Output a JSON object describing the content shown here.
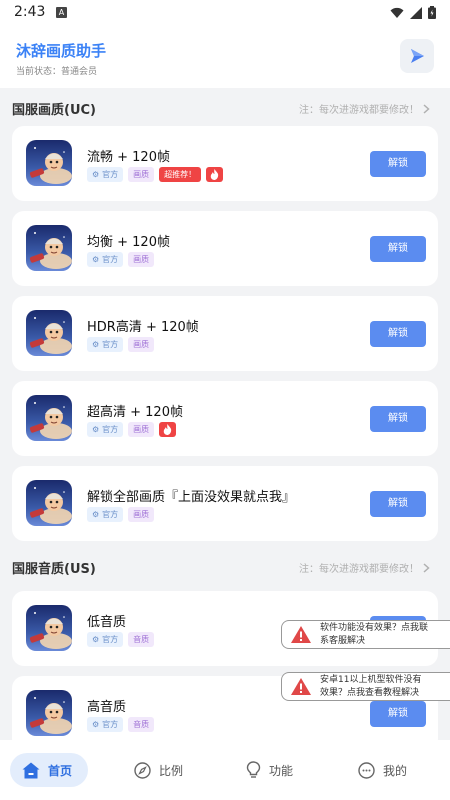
{
  "status_bar": {
    "time": "2:43"
  },
  "header": {
    "title": "沐辞画质助手",
    "member_status": "当前状态：普通会员"
  },
  "sections": [
    {
      "title": "国服画质(UC)",
      "note": "注：每次进游戏都要修改！"
    },
    {
      "title": "国服音质(US)",
      "note": "注：每次进游戏都要修改！"
    }
  ],
  "tag_labels": {
    "official": "官方",
    "quality": "画质",
    "audio": "音质",
    "recommend": "超推荐！"
  },
  "cards": [
    {
      "name": "流畅 + 120帧",
      "button": "解锁"
    },
    {
      "name": "均衡 + 120帧",
      "button": "解锁"
    },
    {
      "name": "HDR高清 + 120帧",
      "button": "解锁"
    },
    {
      "name": "超高清 + 120帧",
      "button": "解锁"
    },
    {
      "name": "解锁全部画质『上面没效果就点我』",
      "button": "解锁"
    },
    {
      "name": "低音质",
      "button": "解锁"
    },
    {
      "name": "高音质",
      "button": "解锁"
    }
  ],
  "toasts": [
    {
      "line1": "软件功能没有效果？点我联",
      "line2": "系客服解决"
    },
    {
      "line1": "安卓11以上机型软件没有",
      "line2": "效果？点我查看教程解决"
    }
  ],
  "nav": [
    {
      "label": "首页",
      "icon": "home-icon"
    },
    {
      "label": "比例",
      "icon": "compass-icon"
    },
    {
      "label": "功能",
      "icon": "bulb-icon"
    },
    {
      "label": "我的",
      "icon": "smile-icon"
    }
  ],
  "colors": {
    "accent": "#3b82f6",
    "button": "#5b8cf0",
    "hot": "#ef4444",
    "background": "#f2f3f5"
  }
}
